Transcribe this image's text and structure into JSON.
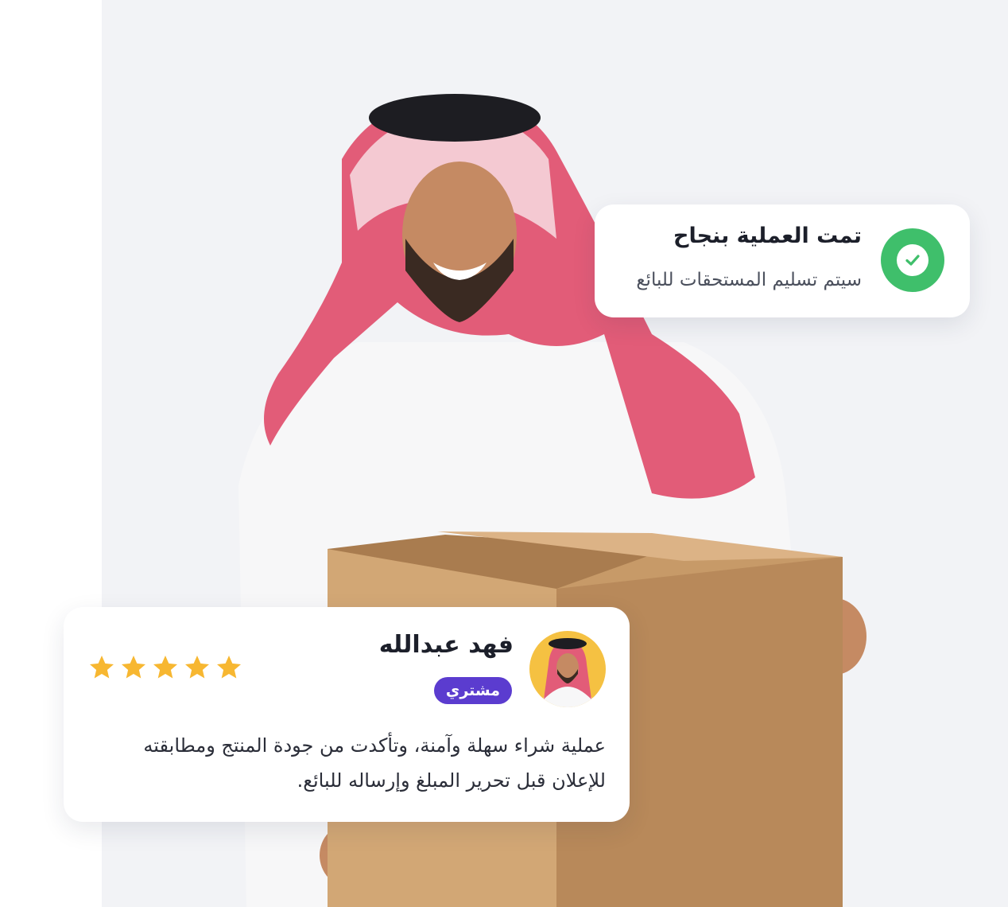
{
  "success_toast": {
    "title": "تمت العملية بنجاح",
    "subtitle": "سيتم تسليم المستحقات للبائع",
    "icon": "check-icon"
  },
  "review": {
    "name": "فهد عبدالله",
    "role": "مشتري",
    "rating": 5,
    "max_rating": 5,
    "text": "عملية شراء سهلة وآمنة، وتأكدت من جودة المنتج ومطابقته للإعلان قبل تحرير المبلغ وإرساله للبائع."
  },
  "colors": {
    "success": "#3fbf6b",
    "badge": "#5b3ccf",
    "star": "#f7b731",
    "avatar_bg": "#f5c142"
  }
}
